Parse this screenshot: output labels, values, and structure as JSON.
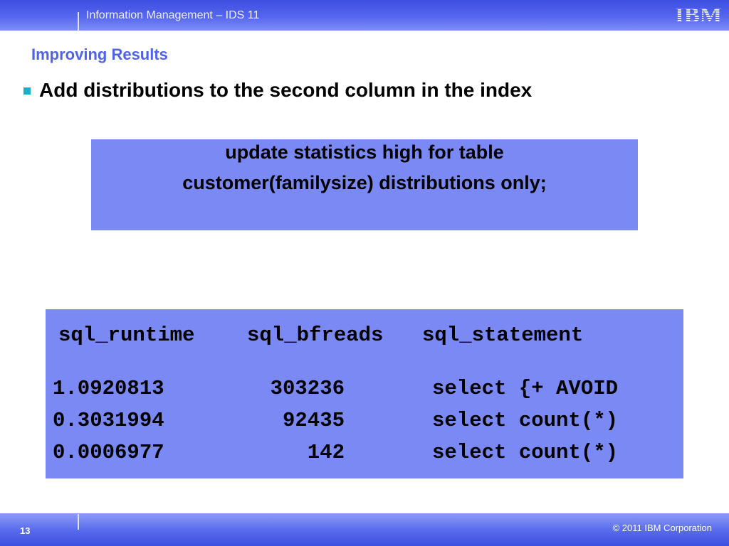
{
  "header": {
    "title": "Information Management – IDS 11",
    "logo_text": "IBM",
    "logo_color": "#ffffff",
    "bar_color": "#4a5ce8"
  },
  "slide": {
    "title": "Improving Results",
    "title_color": "#4f63e8",
    "bullet": {
      "text": "Add distributions to the second column in the index",
      "marker_color": "#17b1c9"
    }
  },
  "sql_box": {
    "lines": [
      "update statistics high for table",
      "customer(familysize) distributions only;"
    ],
    "background_color": "#7b89f5"
  },
  "results_box": {
    "background_color": "#7b89f5",
    "columns": [
      "sql_runtime",
      "sql_bfreads",
      "sql_statement"
    ],
    "rows": [
      {
        "runtime": "1.0920813",
        "bfreads": "303236",
        "statement": "select {+ AVOID"
      },
      {
        "runtime": "0.3031994",
        "bfreads": "92435",
        "statement": "select count(*)"
      },
      {
        "runtime": "0.0006977",
        "bfreads": "142",
        "statement": "select count(*)"
      }
    ]
  },
  "footer": {
    "page_number": "13",
    "copyright": "© 2011 IBM Corporation"
  }
}
